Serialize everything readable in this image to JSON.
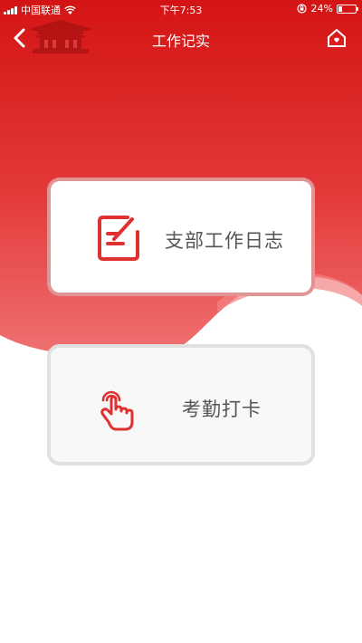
{
  "status_bar": {
    "carrier": "中国联通",
    "time": "下午7:53",
    "battery": "24%",
    "battery_level": 0.24
  },
  "nav": {
    "title": "工作记实",
    "back_icon": "chevron-left-icon",
    "home_icon": "home-icon"
  },
  "menu": {
    "items": [
      {
        "label": "支部工作日志",
        "icon": "notebook-pen-icon"
      },
      {
        "label": "考勤打卡",
        "icon": "hand-tap-icon"
      }
    ]
  },
  "colors": {
    "primary_red": "#d81e1e",
    "gradient_light": "#f07070",
    "label_gray": "#555555"
  }
}
